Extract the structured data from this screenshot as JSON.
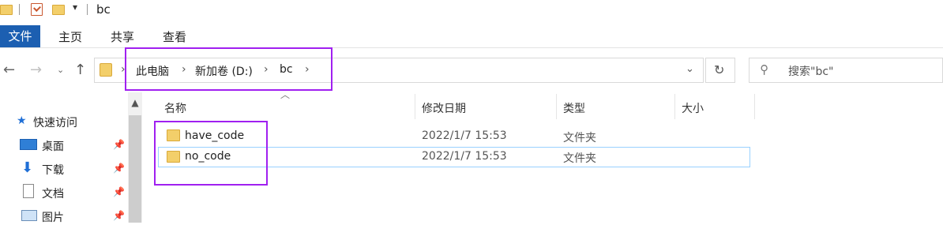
{
  "window": {
    "title": "bc"
  },
  "ribbon": {
    "tabs": [
      {
        "label": "文件"
      },
      {
        "label": "主页"
      },
      {
        "label": "共享"
      },
      {
        "label": "查看"
      }
    ]
  },
  "address": {
    "breadcrumbs": [
      "此电脑",
      "新加卷 (D:)",
      "bc"
    ]
  },
  "search": {
    "placeholder": "搜索\"bc\""
  },
  "sidebar": {
    "header": "快速访问",
    "items": [
      {
        "label": "桌面",
        "icon": "desktop-icon"
      },
      {
        "label": "下载",
        "icon": "download-icon"
      },
      {
        "label": "文档",
        "icon": "document-icon"
      },
      {
        "label": "图片",
        "icon": "picture-icon"
      }
    ]
  },
  "columns": [
    "名称",
    "修改日期",
    "类型",
    "大小"
  ],
  "files": [
    {
      "name": "have_code",
      "modified": "2022/1/7 15:53",
      "type": "文件夹",
      "size": ""
    },
    {
      "name": "no_code",
      "modified": "2022/1/7 15:53",
      "type": "文件夹",
      "size": ""
    }
  ],
  "colors": {
    "accent": "#1c5fb1",
    "selection_border": "#99d1ff",
    "annotation": "#a020f0",
    "folder": "#f3cf6a"
  }
}
